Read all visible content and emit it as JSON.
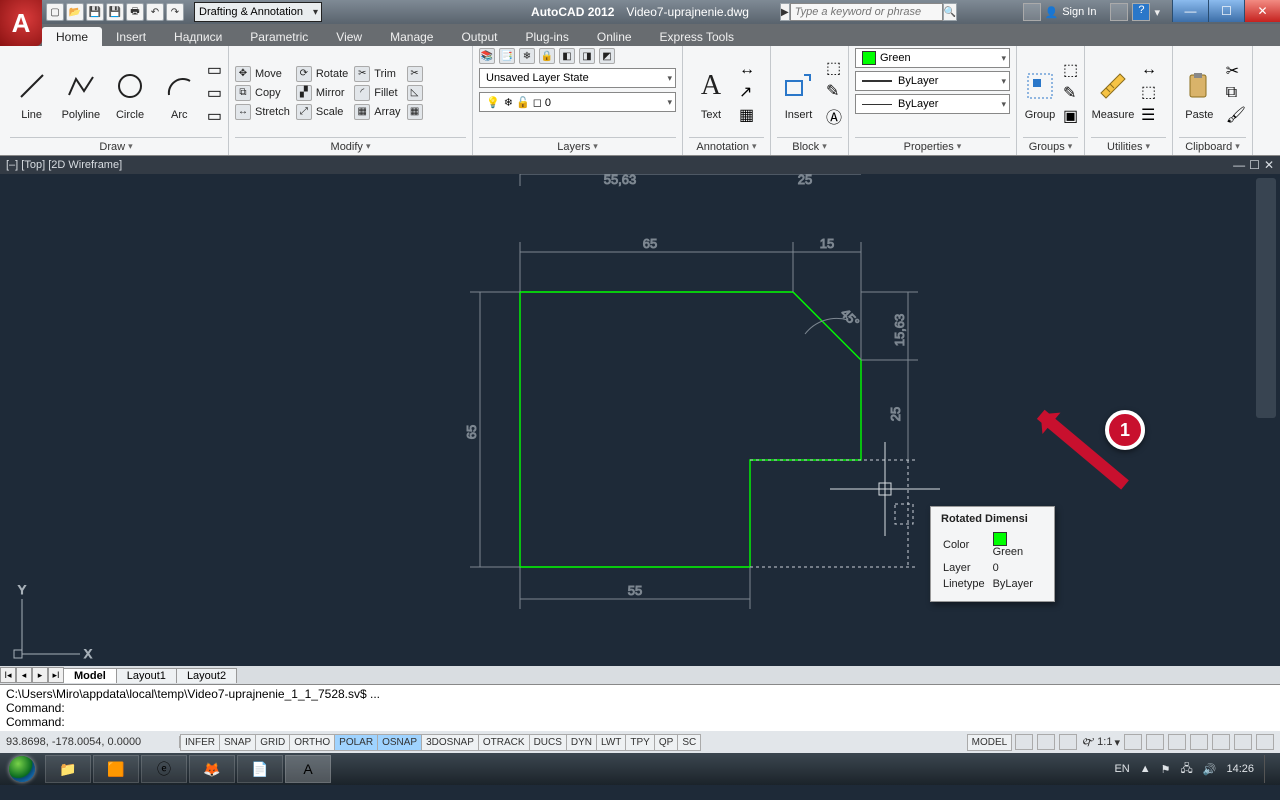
{
  "app": {
    "name": "AutoCAD 2012",
    "file": "Video7-uprajnenie.dwg"
  },
  "qat_icons": [
    "new",
    "open",
    "save",
    "saveas",
    "plot",
    "undo",
    "redo"
  ],
  "workspace": "Drafting & Annotation",
  "search_placeholder": "Type a keyword or phrase",
  "signin": "Sign In",
  "tabs": [
    "Home",
    "Insert",
    "Надписи",
    "Parametric",
    "View",
    "Manage",
    "Output",
    "Plug-ins",
    "Online",
    "Express Tools"
  ],
  "active_tab": "Home",
  "ribbon": {
    "draw": {
      "title": "Draw",
      "items": [
        "Line",
        "Polyline",
        "Circle",
        "Arc"
      ]
    },
    "modify": {
      "title": "Modify",
      "rows": [
        [
          "Move",
          "Rotate",
          "Trim"
        ],
        [
          "Copy",
          "Mirror",
          "Fillet"
        ],
        [
          "Stretch",
          "Scale",
          "Array"
        ]
      ]
    },
    "layers": {
      "title": "Layers",
      "state": "Unsaved Layer State"
    },
    "annotation": {
      "title": "Annotation",
      "big": "Text"
    },
    "block": {
      "title": "Block",
      "big": "Insert"
    },
    "properties": {
      "title": "Properties",
      "color_label": "Green",
      "lt": "ByLayer",
      "lw": "ByLayer"
    },
    "groups": {
      "title": "Groups",
      "big": "Group"
    },
    "utilities": {
      "title": "Utilities",
      "big": "Measure"
    },
    "clipboard": {
      "title": "Clipboard",
      "big": "Paste"
    }
  },
  "viewport_label": "[–] [Top] [2D Wireframe]",
  "dimensions": {
    "d_top_ext1": "55,63",
    "d_top_ext2": "25",
    "d_top1": "65",
    "d_top2": "15",
    "d_right1": "15,63",
    "d_right2": "25",
    "d_left": "65",
    "d_bottom": "55",
    "d_angle": "45°"
  },
  "tooltip": {
    "title": "Rotated Dimensi",
    "rows": [
      [
        "Color",
        "Green"
      ],
      [
        "Layer",
        "0"
      ],
      [
        "Linetype",
        "ByLayer"
      ]
    ]
  },
  "callout_num": "1",
  "layout_tabs": [
    "Model",
    "Layout1",
    "Layout2"
  ],
  "active_layout": "Model",
  "cmd_lines": [
    "C:\\Users\\Miro\\appdata\\local\\temp\\Video7-uprajnenie_1_1_7528.sv$ ...",
    "Command:",
    "",
    "Command:"
  ],
  "coords": "93.8698, -178.0054, 0.0000",
  "toggles": [
    "INFER",
    "SNAP",
    "GRID",
    "ORTHO",
    "POLAR",
    "OSNAP",
    "3DOSNAP",
    "OTRACK",
    "DUCS",
    "DYN",
    "LWT",
    "TPY",
    "QP",
    "SC"
  ],
  "toggles_on": [
    "POLAR",
    "OSNAP"
  ],
  "model_toggle": "MODEL",
  "scale": "1:1",
  "tray": {
    "lang": "EN",
    "time": "14:26"
  }
}
